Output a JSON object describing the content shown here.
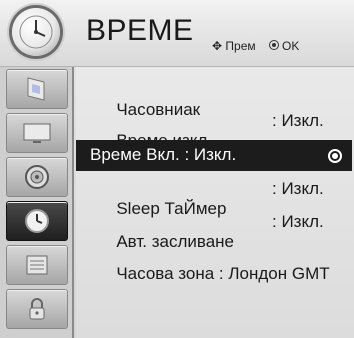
{
  "header": {
    "title": "ВРЕМЕ",
    "move_hint": "Прем",
    "ok_hint": "OK",
    "icon": "clock-icon"
  },
  "sidebar": {
    "items": [
      {
        "icon": "picture-icon",
        "active": false
      },
      {
        "icon": "screen-icon",
        "active": false
      },
      {
        "icon": "audio-icon",
        "active": false
      },
      {
        "icon": "clock-icon",
        "active": true
      },
      {
        "icon": "options-icon",
        "active": false
      },
      {
        "icon": "lock-icon",
        "active": false
      }
    ]
  },
  "menu": {
    "items": [
      {
        "label": "Часовниак",
        "value": ""
      },
      {
        "label": "Време изкл",
        "value": ": Изкл."
      },
      {
        "label": "Време Вкл. : Изкл.",
        "value": "",
        "selected": true
      },
      {
        "label": "Sleep ТаЙмер",
        "value": ": Изкл."
      },
      {
        "label": "Авт. засливане",
        "value": ": Изкл."
      },
      {
        "label": "Часова зона : Лондон GMT",
        "value": ""
      }
    ]
  },
  "colors": {
    "selected_bg": "#1c1c1c",
    "active_tab_bg": "#2a2a2a",
    "panel_bg": "#e3e3e3"
  }
}
